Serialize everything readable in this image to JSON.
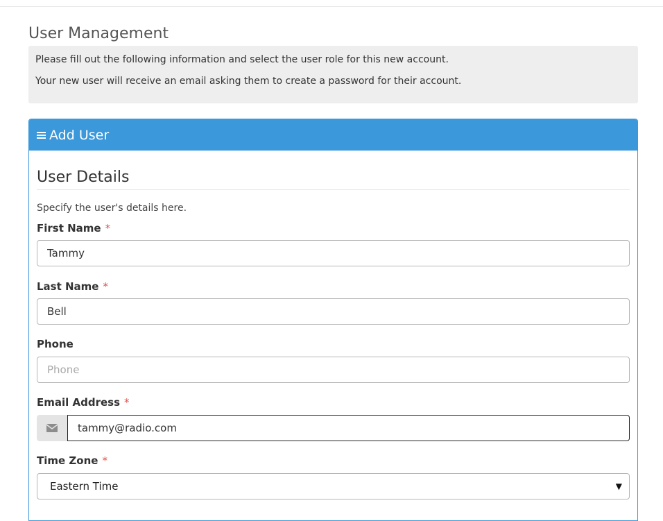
{
  "page": {
    "title": "User Management",
    "info_lines": [
      "Please fill out the following information and select the user role for this new account.",
      "Your new user will receive an email asking them to create a password for their account."
    ]
  },
  "panel": {
    "heading": "Add User",
    "heading_icon": "hamburger-icon",
    "section_title": "User Details",
    "section_desc": "Specify the user's details here."
  },
  "form": {
    "first_name": {
      "label": "First Name",
      "required_mark": "*",
      "value": "Tammy"
    },
    "last_name": {
      "label": "Last Name",
      "required_mark": "*",
      "value": "Bell"
    },
    "phone": {
      "label": "Phone",
      "placeholder": "Phone",
      "value": ""
    },
    "email": {
      "label": "Email Address",
      "required_mark": "*",
      "value": "tammy@radio.com",
      "icon": "envelope-icon"
    },
    "time_zone": {
      "label": "Time Zone",
      "required_mark": "*",
      "selected": "Eastern Time",
      "icon": "caret-down-icon"
    }
  },
  "colors": {
    "accent": "#3a98db",
    "required": "#d9534f",
    "info_bg": "#eeeeee"
  }
}
